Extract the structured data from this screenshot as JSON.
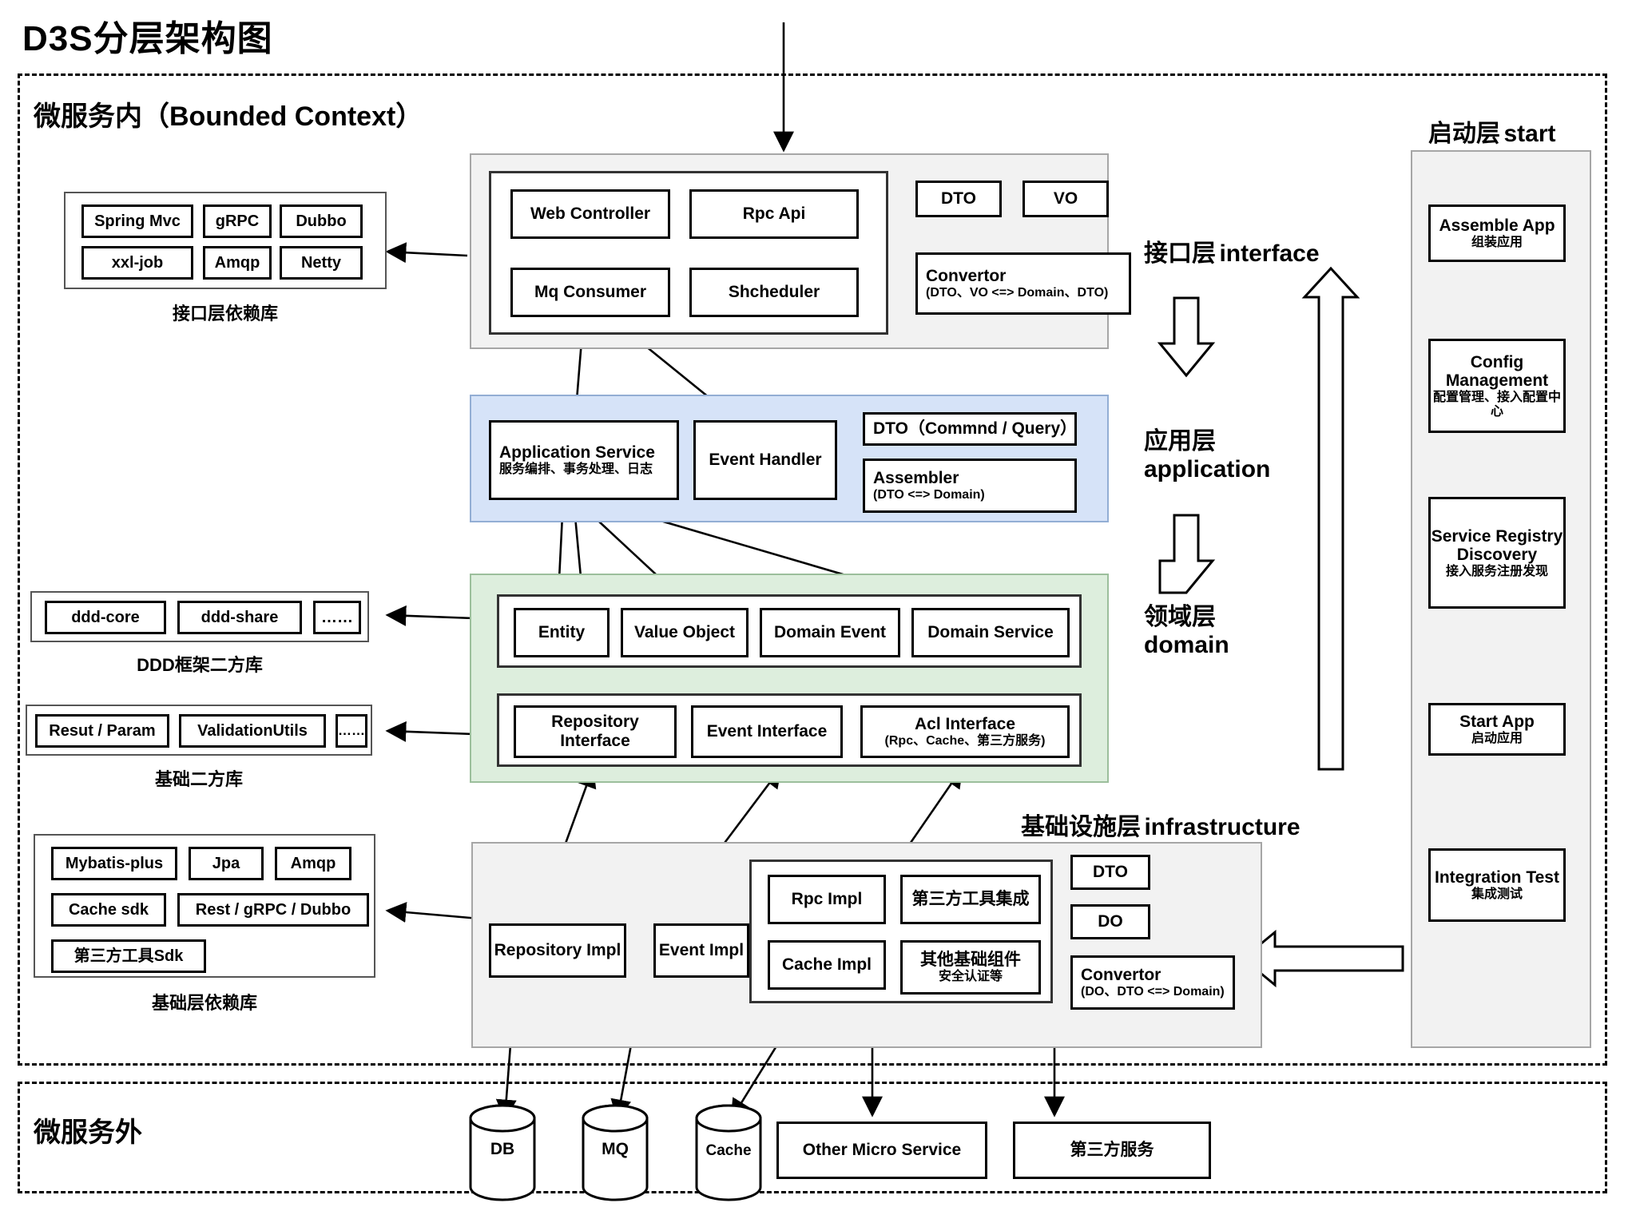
{
  "title": "D3S分层架构图",
  "zones": {
    "inner": "微服务内（Bounded Context）",
    "outer": "微服务外"
  },
  "layer_labels": {
    "interface": {
      "cn": "接口层",
      "en": "interface"
    },
    "application": {
      "cn": "应用层",
      "en": "application"
    },
    "domain": {
      "cn": "领域层",
      "en": "domain"
    },
    "infrastructure": {
      "cn": "基础设施层",
      "en": "infrastructure"
    },
    "start": {
      "cn": "启动层",
      "en": "start"
    }
  },
  "interface_layer": {
    "components": [
      "Web Controller",
      "Rpc Api",
      "Mq Consumer",
      "Shcheduler"
    ],
    "models": [
      "DTO",
      "VO"
    ],
    "convertor": {
      "title": "Convertor",
      "sub": "(DTO、VO <=> Domain、DTO)"
    }
  },
  "interface_deps": {
    "caption": "接口层依赖库",
    "items": [
      "Spring Mvc",
      "gRPC",
      "Dubbo",
      "xxl-job",
      "Amqp",
      "Netty"
    ]
  },
  "application_layer": {
    "service": {
      "title": "Application Service",
      "sub": "服务编排、事务处理、日志"
    },
    "event_handler": "Event Handler",
    "dto": "DTO（Commnd / Query）",
    "assembler": {
      "title": "Assembler",
      "sub": "(DTO <=> Domain)"
    }
  },
  "domain_layer": {
    "row1": [
      "Entity",
      "Value Object",
      "Domain Event",
      "Domain Service"
    ],
    "repository_interface": "Repository Interface",
    "event_interface": "Event Interface",
    "acl_interface": {
      "title": "Acl Interface",
      "sub": "(Rpc、Cache、第三方服务)"
    }
  },
  "ddd_deps": {
    "caption": "DDD框架二方库",
    "items": [
      "ddd-core",
      "ddd-share",
      "……"
    ]
  },
  "base_deps": {
    "caption": "基础二方库",
    "items": [
      "Resut / Param",
      "ValidationUtils",
      "……"
    ]
  },
  "infra_deps": {
    "caption": "基础层依赖库",
    "items": [
      "Mybatis-plus",
      "Jpa",
      "Amqp",
      "Cache sdk",
      "Rest / gRPC / Dubbo",
      "第三方工具Sdk"
    ]
  },
  "infrastructure_layer": {
    "repository_impl": "Repository Impl",
    "event_impl": "Event Impl",
    "rpc_impl": "Rpc  Impl",
    "cache_impl": "Cache Impl",
    "third_party_tools": "第三方工具集成",
    "other_components": {
      "title": "其他基础组件",
      "sub": "安全认证等"
    },
    "models": [
      "DTO",
      "DO"
    ],
    "convertor": {
      "title": "Convertor",
      "sub": "(DO、DTO <=> Domain)"
    }
  },
  "start_layer": {
    "items": [
      {
        "en": "Assemble App",
        "cn": "组装应用"
      },
      {
        "en": "Config Management",
        "cn": "配置管理、接入配置中心"
      },
      {
        "en": "Service Registry Discovery",
        "cn": "接入服务注册发现"
      },
      {
        "en": "Start App",
        "cn": "启动应用"
      },
      {
        "en": "Integration Test",
        "cn": "集成测试"
      }
    ]
  },
  "external": [
    {
      "label": "DB",
      "shape": "cylinder"
    },
    {
      "label": "MQ",
      "shape": "cylinder"
    },
    {
      "label": "Cache",
      "shape": "cylinder"
    },
    {
      "label": "Other Micro Service",
      "shape": "rect"
    },
    {
      "label": "第三方服务",
      "shape": "rect"
    }
  ],
  "colors": {
    "interface_bg": "#f2f2f2",
    "application_bg": "#d6e3f8",
    "domain_bg": "#ddeedd",
    "infrastructure_bg": "#f2f2f2",
    "start_bg": "#f2f2f2"
  }
}
